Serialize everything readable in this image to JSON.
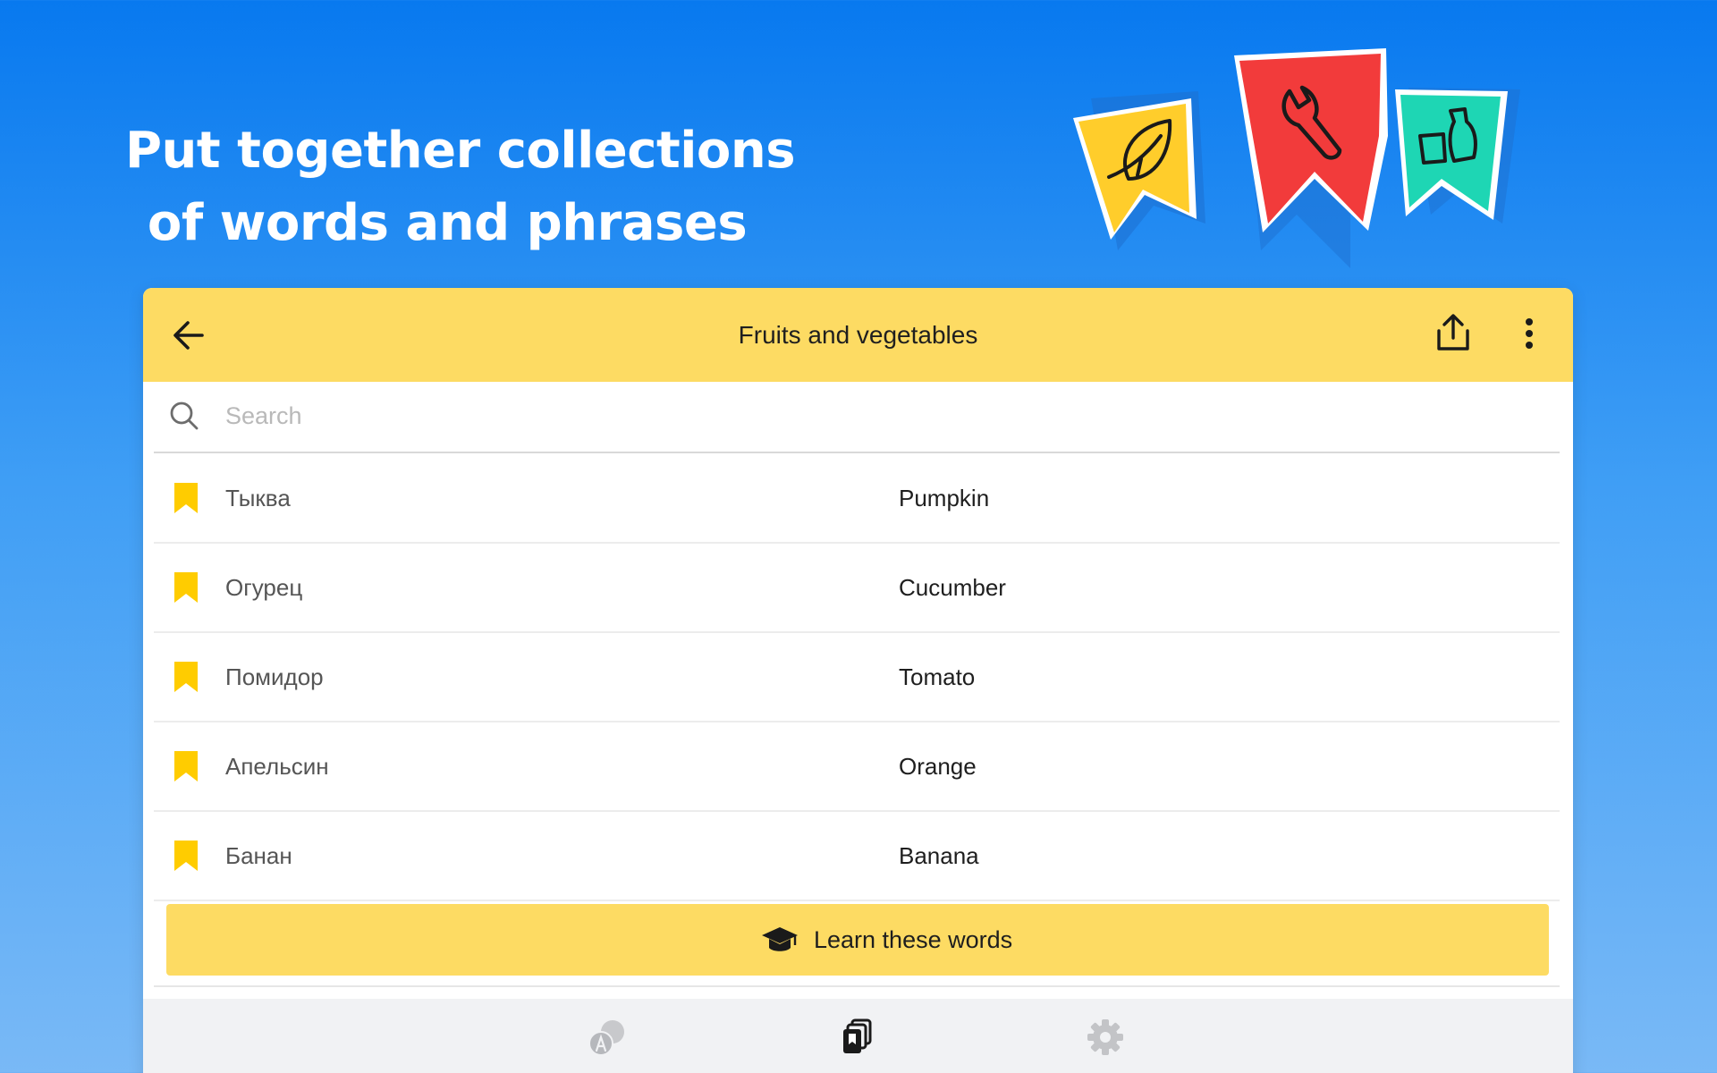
{
  "headline": {
    "line1": "Put together collections",
    "line2": "of words and phrases"
  },
  "decorations": [
    "leaf-icon",
    "wrench-icon",
    "bottle-cup-icon"
  ],
  "appbar": {
    "title": "Fruits and vegetables",
    "back_icon": "arrow-left-icon",
    "share_icon": "share-icon",
    "more_icon": "more-vertical-icon"
  },
  "search": {
    "placeholder": "Search",
    "value": ""
  },
  "words": [
    {
      "source": "Тыква",
      "translation": "Pumpkin"
    },
    {
      "source": "Огурец",
      "translation": "Cucumber"
    },
    {
      "source": "Помидор",
      "translation": "Tomato"
    },
    {
      "source": "Апельсин",
      "translation": "Orange"
    },
    {
      "source": "Банан",
      "translation": "Banana"
    }
  ],
  "learn_button": {
    "label": "Learn these words",
    "icon": "graduation-cap-icon"
  },
  "bottom_nav": {
    "tabs": [
      "translate-icon",
      "collections-icon",
      "settings-icon"
    ],
    "active": "collections-icon"
  },
  "colors": {
    "accent": "#fddb63",
    "bookmark": "#ffcc00",
    "background_top": "#0879ef",
    "background_bottom": "#79b9f6"
  }
}
